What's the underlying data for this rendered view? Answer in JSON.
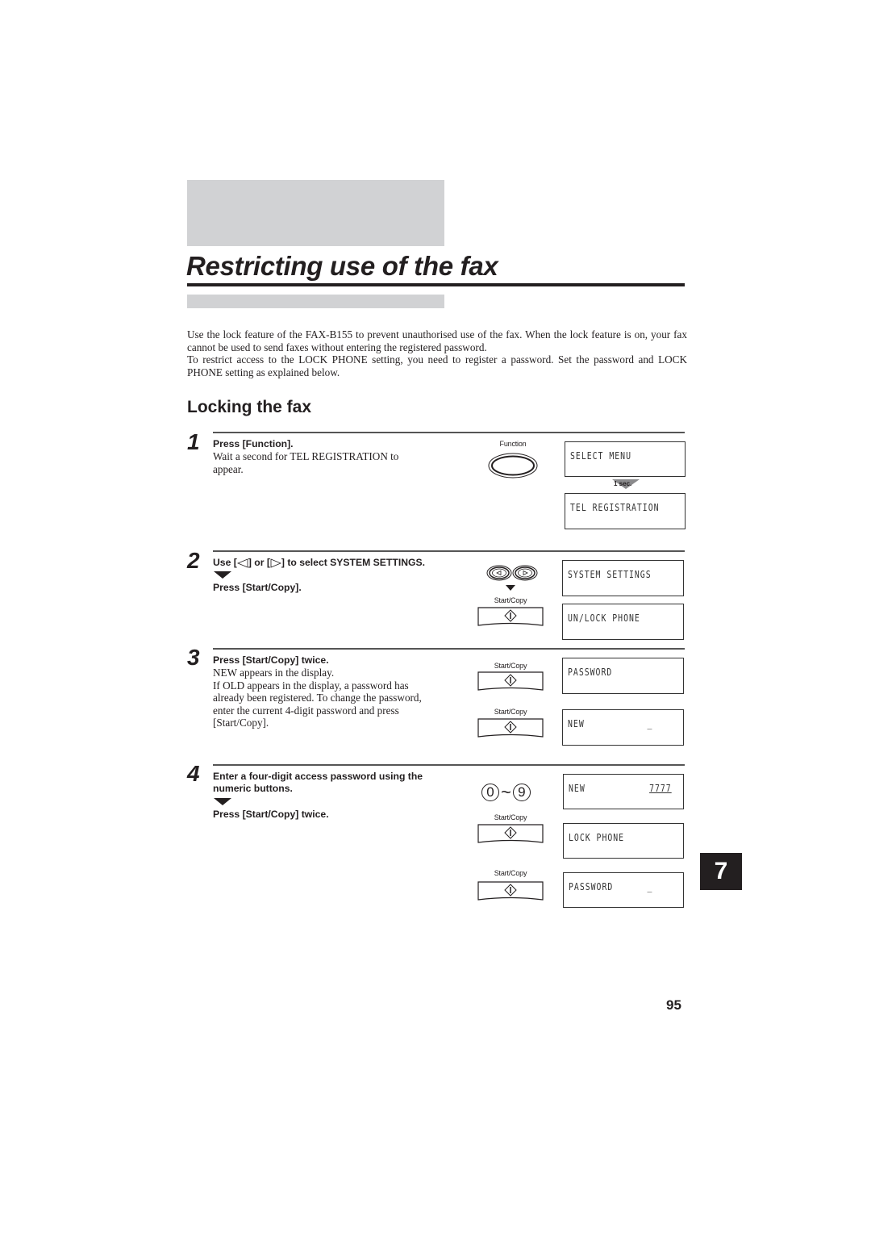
{
  "page": {
    "title": "Restricting use of the fax",
    "intro": [
      "Use the lock feature of the FAX-B155 to prevent unauthorised use of the fax. When the lock feature is on, your fax cannot be used to send faxes without entering the registered password.",
      "To restrict access to the LOCK PHONE setting, you need to register a password. Set the password and LOCK PHONE setting as explained below."
    ],
    "section_title": "Locking the fax",
    "chapter_tab": "7",
    "page_number": "95"
  },
  "steps": [
    {
      "number": "1",
      "bold": "Press [Function].",
      "text": [
        "Wait a second for TEL REGISTRATION to",
        "appear."
      ],
      "button_label": "Function",
      "displays": [
        "SELECT MENU",
        "TEL REGISTRATION"
      ],
      "delay_label": "1 sec."
    },
    {
      "number": "2",
      "bold_parts": [
        "Use [",
        "] or [",
        "] to select SYSTEM SETTINGS."
      ],
      "bold2": "Press [Start/Copy].",
      "button_label": "Start/Copy",
      "displays": [
        "SYSTEM SETTINGS",
        "UN/LOCK PHONE"
      ]
    },
    {
      "number": "3",
      "bold": "Press [Start/Copy] twice.",
      "text": [
        "NEW appears in the display.",
        "If OLD appears in the display, a password has",
        "already been registered. To change the password,",
        "enter the current 4-digit password and press",
        "[Start/Copy]."
      ],
      "button_labels": [
        "Start/Copy",
        "Start/Copy"
      ],
      "displays": [
        {
          "left": "PASSWORD",
          "right": ""
        },
        {
          "left": "NEW",
          "right": "_"
        }
      ]
    },
    {
      "number": "4",
      "bold": [
        "Enter a four-digit access password using the",
        "numeric buttons."
      ],
      "bold2": "Press [Start/Copy] twice.",
      "numeric": {
        "from": "0",
        "tilde": "~",
        "to": "9"
      },
      "button_labels": [
        "Start/Copy",
        "Start/Copy"
      ],
      "displays": [
        {
          "left": "NEW",
          "right": "7777"
        },
        {
          "left": "LOCK PHONE",
          "right": ""
        },
        {
          "left": "PASSWORD",
          "right": "_"
        }
      ]
    }
  ]
}
